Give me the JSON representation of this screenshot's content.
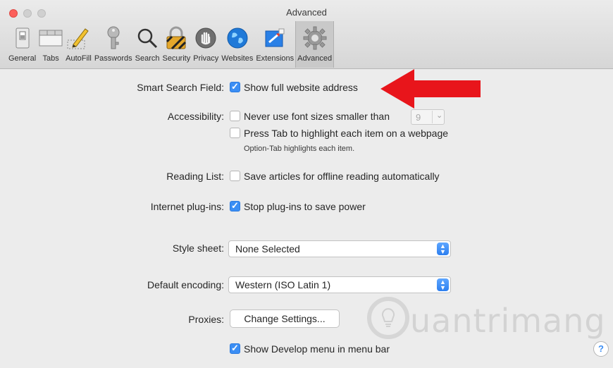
{
  "window": {
    "title": "Advanced"
  },
  "toolbar": {
    "tabs": [
      {
        "label": "General",
        "icon": "switch-icon"
      },
      {
        "label": "Tabs",
        "icon": "tabs-icon"
      },
      {
        "label": "AutoFill",
        "icon": "pencil-icon"
      },
      {
        "label": "Passwords",
        "icon": "key-icon"
      },
      {
        "label": "Search",
        "icon": "magnifier-icon"
      },
      {
        "label": "Security",
        "icon": "lock-icon"
      },
      {
        "label": "Privacy",
        "icon": "hand-icon"
      },
      {
        "label": "Websites",
        "icon": "globe-icon"
      },
      {
        "label": "Extensions",
        "icon": "puzzle-icon"
      },
      {
        "label": "Advanced",
        "icon": "gear-icon",
        "active": true
      }
    ]
  },
  "smart_search": {
    "label": "Smart Search Field:",
    "option": "Show full website address",
    "checked": true
  },
  "accessibility": {
    "label": "Accessibility:",
    "font_option": "Never use font sizes smaller than",
    "font_value": "9",
    "tab_option": "Press Tab to highlight each item on a webpage",
    "tab_note": "Option-Tab highlights each item."
  },
  "reading_list": {
    "label": "Reading List:",
    "option": "Save articles for offline reading automatically"
  },
  "plugins": {
    "label": "Internet plug-ins:",
    "option": "Stop plug-ins to save power",
    "checked": true
  },
  "style_sheet": {
    "label": "Style sheet:",
    "value": "None Selected"
  },
  "encoding": {
    "label": "Default encoding:",
    "value": "Western (ISO Latin 1)"
  },
  "proxies": {
    "label": "Proxies:",
    "button": "Change Settings..."
  },
  "develop": {
    "option": "Show Develop menu in menu bar",
    "checked": true
  },
  "watermark": {
    "text": "uantrimang"
  },
  "help": {
    "symbol": "?"
  },
  "colors": {
    "accent": "#3b8ef4",
    "annotation_arrow": "#e8151b"
  }
}
